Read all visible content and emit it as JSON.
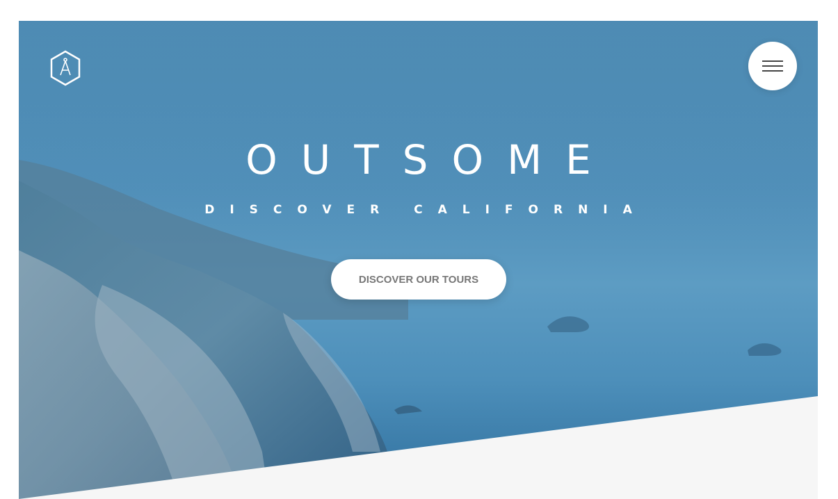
{
  "header": {
    "logo_icon": "compass-hexagon-icon",
    "menu_icon": "hamburger-menu-icon"
  },
  "hero": {
    "brand": "OUTSOME",
    "tagline": "DISCOVER CALIFORNIA",
    "cta_label": "DISCOVER OUR TOURS"
  },
  "colors": {
    "overlay": "#4a8ab5",
    "band": "#f6f6f6",
    "cta_text": "#777777",
    "text": "#ffffff"
  }
}
